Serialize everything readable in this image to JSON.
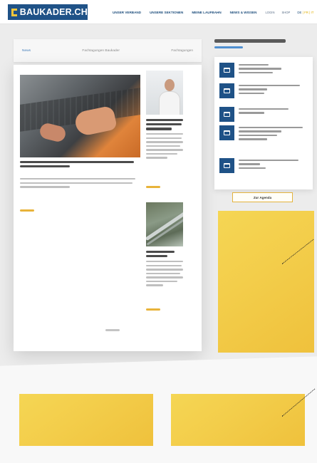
{
  "header": {
    "logo": "BAUKADER.CH",
    "nav": [
      {
        "label": "Unser Verband"
      },
      {
        "label": "Unsere Sektionen"
      },
      {
        "label": "Meine Laufbahn"
      },
      {
        "label": "News & Wissen"
      }
    ],
    "small_links": [
      {
        "label": "Login"
      },
      {
        "label": "Shop"
      }
    ],
    "lang": {
      "de": "DE",
      "fr": "FR",
      "it": "IT",
      "sep": "|"
    }
  },
  "tabs": [
    "News",
    "Fachtagungen Baukader",
    "Fachtagungen"
  ],
  "sidebar": {
    "agenda_button": "Zur Agenda"
  }
}
